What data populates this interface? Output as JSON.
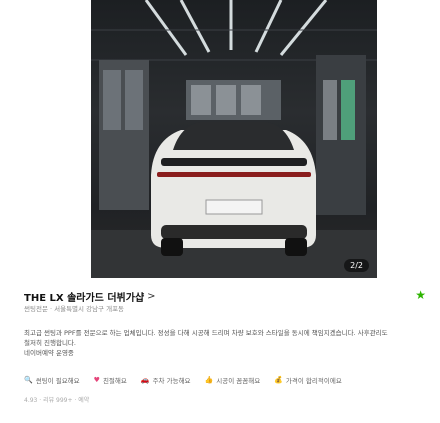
{
  "photo": {
    "counter": "2/2"
  },
  "place": {
    "title": "THE LX 솔라가드 더뷔가샵",
    "chevron": ">",
    "subtitle": "썬팅전문 · 서울특별시 강남구 개포동",
    "favorite_icon": "star-icon"
  },
  "description": [
    "최고급 썬팅과 PPF를 전문으로 하는 업체입니다. 정성을 다해 시공해 드리며 차량 보호와 스타일을 동시에 책임지겠습니다. 사후관리도",
    "철저히 진행합니다.",
    "네이버예약 운영중"
  ],
  "tags": [
    {
      "icon": "search-icon",
      "label": "썬팅이 필요해요"
    },
    {
      "icon": "heart-icon",
      "label": "친절해요"
    },
    {
      "icon": "car-icon",
      "label": "주차 가능해요"
    },
    {
      "icon": "thumbs-up-icon",
      "label": "시공이 꼼꼼해요"
    },
    {
      "icon": "money-icon",
      "label": "가격이 합리적이에요"
    }
  ],
  "meta": "4.93 · 리뷰 999+ · 예약"
}
